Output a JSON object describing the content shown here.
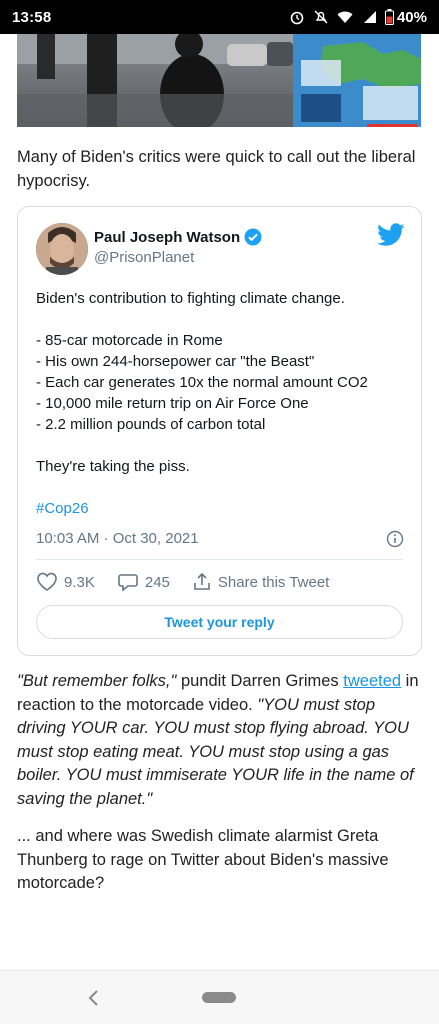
{
  "status_bar": {
    "time": "13:58",
    "battery": "40%",
    "icons": [
      "alarm-icon",
      "mute-icon",
      "wifi-icon",
      "signal-icon",
      "battery-icon"
    ]
  },
  "article": {
    "intro": "Many of Biden's critics were quick to call out the liberal hypocrisy.",
    "quote_part1": "\"But remember folks,\"",
    "quote_part2": " pundit Darren Grimes ",
    "quote_link": "tweeted",
    "quote_part3": " in reaction to the motorcade video. ",
    "quote_part4": "\"YOU must stop driving YOUR car. YOU must stop flying abroad. YOU must stop eating meat. YOU must stop using a gas boiler. YOU must immiserate YOUR life in the name of saving the planet.\"",
    "closing": "... and where was Swedish climate alarmist Greta Thunberg to rage on Twitter about Biden's massive motorcade?"
  },
  "tweet": {
    "name": "Paul Joseph Watson",
    "handle": "@PrisonPlanet",
    "lines": [
      "Biden's contribution to fighting climate change.",
      "",
      "- 85-car motorcade in Rome",
      "- His own 244-horsepower car \"the Beast\"",
      "- Each car generates 10x the normal amount CO2",
      "- 10,000 mile return trip on Air Force One",
      "- 2.2 million pounds of carbon total",
      "",
      "They're taking the piss.",
      ""
    ],
    "hashtag": "#Cop26",
    "timestamp": "10:03 AM · Oct 30, 2021",
    "likes": "9.3K",
    "replies": "245",
    "share_label": "Share this Tweet",
    "reply_button": "Tweet your reply"
  },
  "colors": {
    "twitter_blue": "#1b95e0",
    "muted_gray": "#657786",
    "status_bar_bg": "#000000"
  }
}
